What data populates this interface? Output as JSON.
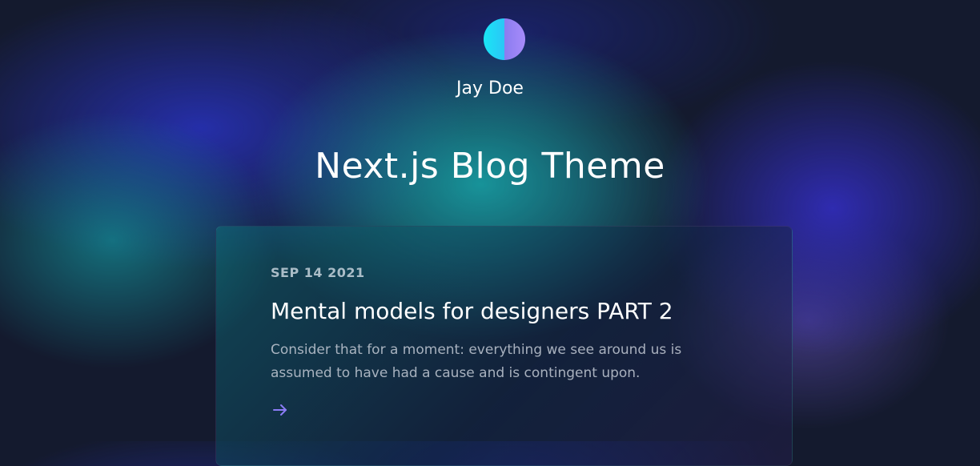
{
  "author": {
    "name": "Jay Doe",
    "avatar_colors": [
      "#19e6f5",
      "#a78bfa"
    ]
  },
  "blog": {
    "title": "Next.js Blog Theme"
  },
  "posts": [
    {
      "date": "SEP 14 2021",
      "title": "Mental models for designers PART 2",
      "excerpt": "Consider that for a moment: everything we see around us is assumed to have had a cause and is contingent upon.",
      "read_more_icon": "arrow-right-icon",
      "accent_color": "#8b7cf6"
    }
  ]
}
